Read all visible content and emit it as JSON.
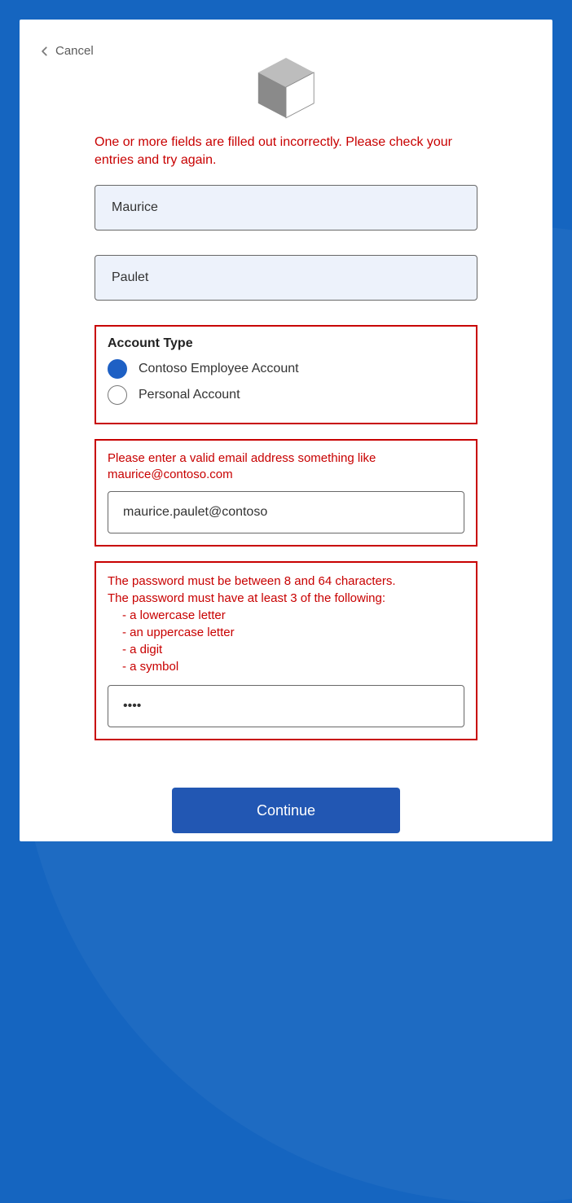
{
  "header": {
    "cancel_label": "Cancel"
  },
  "errors": {
    "top": "One or more fields are filled out incorrectly. Please check your entries and try again.",
    "email": "Please enter a valid email address something like maurice@contoso.com",
    "password_line1": "The password must be between 8 and 64 characters.",
    "password_line2": "The password must have at least 3 of the following:",
    "password_reqs": [
      "- a lowercase letter",
      "- an uppercase letter",
      "- a digit",
      "- a symbol"
    ]
  },
  "form": {
    "first_name": "Maurice",
    "last_name": "Paulet",
    "account_type_label": "Account Type",
    "account_options": {
      "employee": "Contoso Employee Account",
      "personal": "Personal Account"
    },
    "account_selected": "employee",
    "email": "maurice.paulet@contoso",
    "password": "••••",
    "continue_label": "Continue"
  }
}
